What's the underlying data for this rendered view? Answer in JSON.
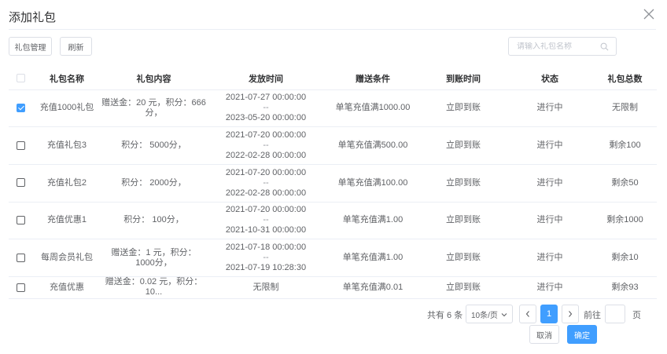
{
  "dialog": {
    "title": "添加礼包"
  },
  "toolbar": {
    "manage_label": "礼包管理",
    "refresh_label": "刷新"
  },
  "search": {
    "placeholder": "请输入礼包名称",
    "value": ""
  },
  "table": {
    "headers": [
      "礼包名称",
      "礼包内容",
      "发放时间",
      "赠送条件",
      "到账时间",
      "状态",
      "礼包总数"
    ],
    "rows": [
      {
        "checked": true,
        "name": "充值1000礼包",
        "content": "赠送金：20 元，积分：666分，",
        "time_start": "2021-07-27 00:00:00",
        "time_sep": "--",
        "time_end": "2023-05-20 00:00:00",
        "condition": "单笔充值满1000.00",
        "arrival": "立即到账",
        "status": "进行中",
        "total": "无限制"
      },
      {
        "checked": false,
        "name": "充值礼包3",
        "content": "积分： 5000分，",
        "time_start": "2021-07-20 00:00:00",
        "time_sep": "--",
        "time_end": "2022-02-28 00:00:00",
        "condition": "单笔充值满500.00",
        "arrival": "立即到账",
        "status": "进行中",
        "total": "剩余100"
      },
      {
        "checked": false,
        "name": "充值礼包2",
        "content": "积分： 2000分，",
        "time_start": "2021-07-20 00:00:00",
        "time_sep": "--",
        "time_end": "2022-02-28 00:00:00",
        "condition": "单笔充值满100.00",
        "arrival": "立即到账",
        "status": "进行中",
        "total": "剩余50"
      },
      {
        "checked": false,
        "name": "充值优惠1",
        "content": "积分： 100分，",
        "time_start": "2021-07-20 00:00:00",
        "time_sep": "--",
        "time_end": "2021-10-31 00:00:00",
        "condition": "单笔充值满1.00",
        "arrival": "立即到账",
        "status": "进行中",
        "total": "剩余1000"
      },
      {
        "checked": false,
        "name": "每周会员礼包",
        "content": "赠送金：1 元，积分： 1000分，",
        "time_start": "2021-07-18 00:00:00",
        "time_sep": "--",
        "time_end": "2021-07-19 10:28:30",
        "condition": "单笔充值满1.00",
        "arrival": "立即到账",
        "status": "进行中",
        "total": "剩余10"
      },
      {
        "checked": false,
        "name": "充值优惠",
        "content": "赠送金：0.02 元，积分： 10...",
        "time_single": "无限制",
        "condition": "单笔充值满0.01",
        "arrival": "立即到账",
        "status": "进行中",
        "total": "剩余93"
      }
    ]
  },
  "pagination": {
    "total_text": "共有 6 条",
    "page_size": "10条/页",
    "current_page": "1",
    "goto_label": "前往",
    "goto_value": "",
    "unit_label": "页"
  },
  "footer": {
    "cancel_label": "取消",
    "confirm_label": "确定"
  },
  "colors": {
    "primary": "#409eff",
    "border": "#dcdfe6",
    "text": "#606266"
  }
}
